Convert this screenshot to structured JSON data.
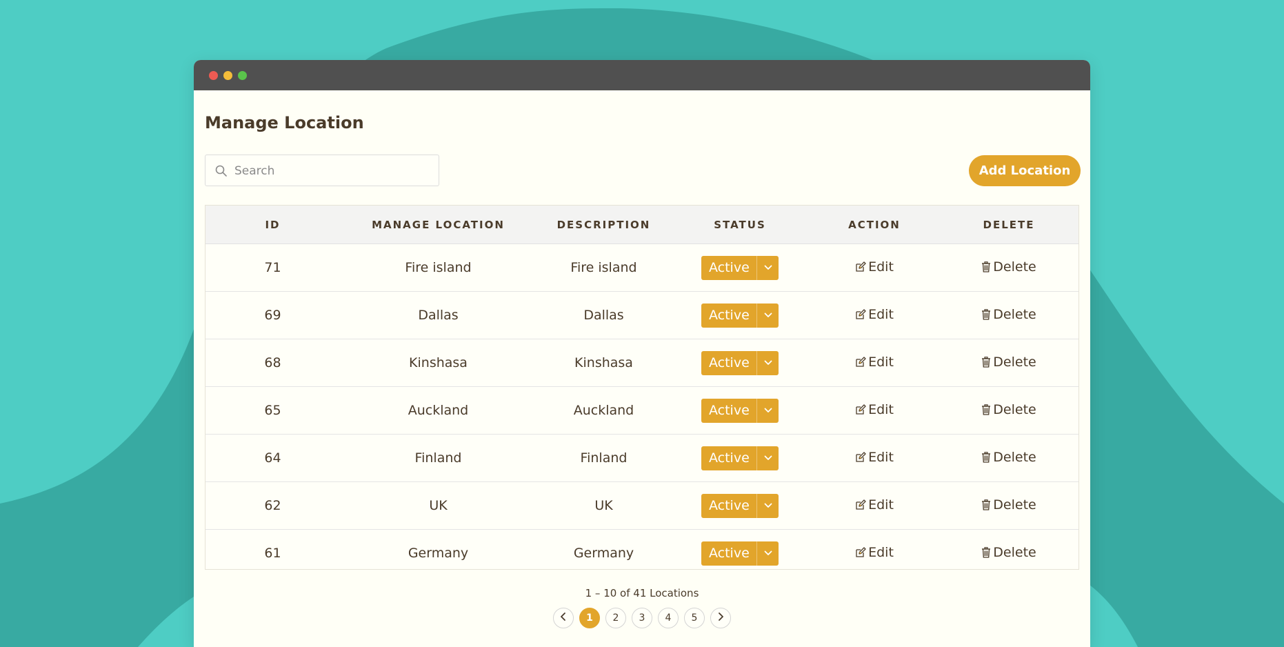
{
  "page": {
    "title": "Manage Location"
  },
  "search": {
    "placeholder": "Search",
    "value": ""
  },
  "actions": {
    "add_label": "Add Location"
  },
  "table": {
    "columns": [
      "ID",
      "MANAGE LOCATION",
      "DESCRIPTION",
      "STATUS",
      "ACTION",
      "DELETE"
    ],
    "edit_label": "Edit",
    "delete_label": "Delete",
    "rows": [
      {
        "id": "71",
        "location": "Fire island",
        "description": "Fire island",
        "status": "Active"
      },
      {
        "id": "69",
        "location": "Dallas",
        "description": "Dallas",
        "status": "Active"
      },
      {
        "id": "68",
        "location": "Kinshasa",
        "description": "Kinshasa",
        "status": "Active"
      },
      {
        "id": "65",
        "location": "Auckland",
        "description": "Auckland",
        "status": "Active"
      },
      {
        "id": "64",
        "location": "Finland",
        "description": "Finland",
        "status": "Active"
      },
      {
        "id": "62",
        "location": "UK",
        "description": "UK",
        "status": "Active"
      },
      {
        "id": "61",
        "location": "Germany",
        "description": "Germany",
        "status": "Active"
      }
    ]
  },
  "pagination": {
    "summary": "1 – 10 of 41 Locations",
    "pages": [
      "1",
      "2",
      "3",
      "4",
      "5"
    ],
    "current": "1"
  },
  "colors": {
    "accent": "#e2a52b",
    "background": "#4ecdc4",
    "background_dark": "#38aaa2",
    "titlebar": "#505050",
    "text": "#4a3b2a"
  },
  "icons": {
    "search": "search-icon",
    "edit": "edit-icon",
    "delete": "trash-icon",
    "dropdown": "chevron-down-icon",
    "prev": "chevron-left-icon",
    "next": "chevron-right-icon"
  }
}
